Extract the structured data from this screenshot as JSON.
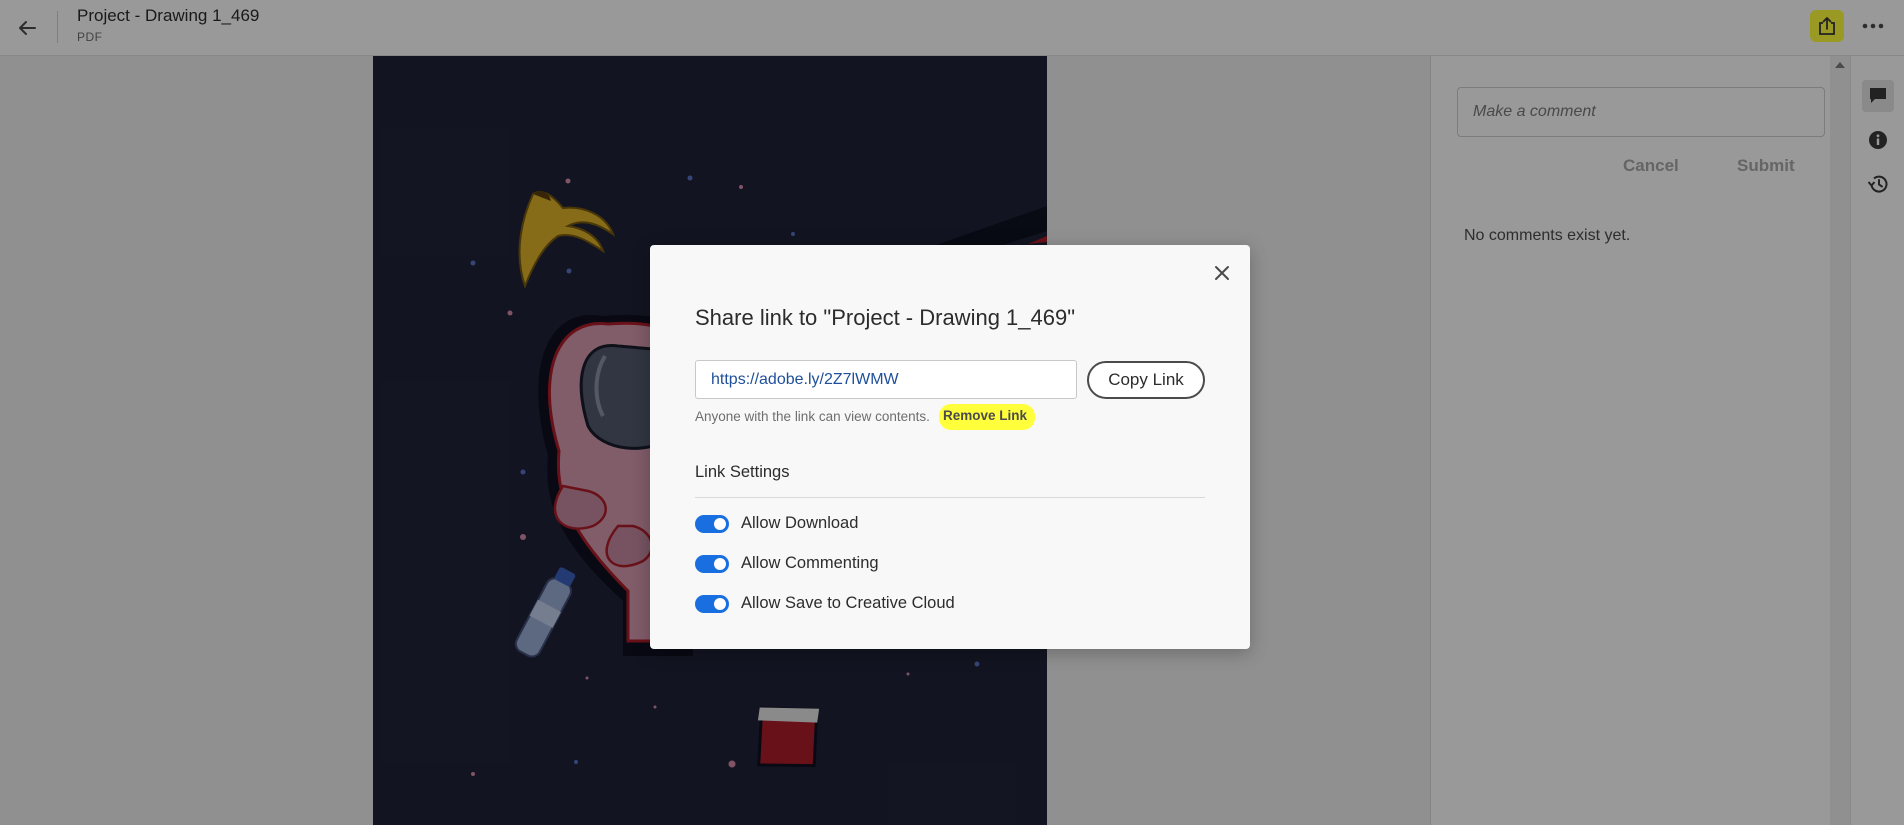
{
  "header": {
    "title": "Project - Drawing 1_469",
    "doc_type": "PDF"
  },
  "comments": {
    "input_placeholder": "Make a comment",
    "cancel_label": "Cancel",
    "submit_label": "Submit",
    "empty_text": "No comments exist yet."
  },
  "icons": {
    "back": "arrow-left-icon",
    "share": "share-icon",
    "more": "more-icon",
    "comments": "comment-icon",
    "info": "info-icon",
    "history": "history-icon",
    "close": "close-icon"
  },
  "colors": {
    "highlight": "#ffff3c",
    "toggle_on": "#1a6fe0",
    "link_text": "#1f4f9a"
  },
  "modal": {
    "title": "Share link to \"Project - Drawing 1_469\"",
    "link_value": "https://adobe.ly/2Z7lWMW",
    "copy_label": "Copy Link",
    "note": "Anyone with the link can view contents.",
    "remove_label": "Remove Link",
    "settings_title": "Link Settings",
    "settings": [
      {
        "label": "Allow Download",
        "enabled": true
      },
      {
        "label": "Allow Commenting",
        "enabled": true
      },
      {
        "label": "Allow Save to Creative Cloud",
        "enabled": true
      }
    ]
  }
}
